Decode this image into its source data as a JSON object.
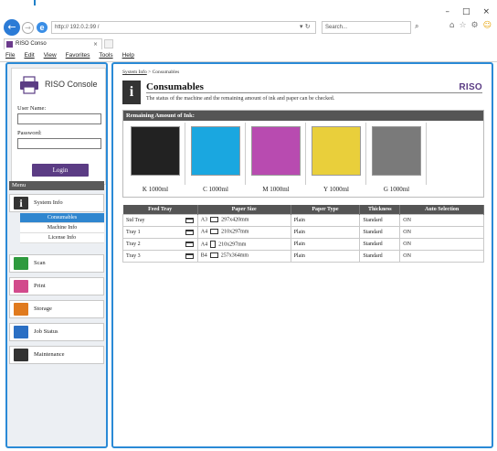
{
  "window": {
    "min": "–",
    "max": "□",
    "close": "×"
  },
  "browser": {
    "back": "←",
    "forward": "→",
    "ie_logo": "e",
    "url": "http:// 192.0.2.99 /",
    "url_actions": "▾ ↻",
    "search_placeholder": "Search...",
    "search_icon": "⌕",
    "tab_title": "RISO Conso",
    "tab_close": "×",
    "menus": [
      "File",
      "Edit",
      "View",
      "Favorites",
      "Tools",
      "Help"
    ],
    "toolbar_icons": {
      "home": "⌂",
      "favorites": "☆",
      "settings": "⚙",
      "feedback": "☺"
    }
  },
  "login": {
    "logo_text": "RISO Console",
    "username_label": "User Name:",
    "password_label": "Password:",
    "button_label": "Login"
  },
  "menu": {
    "header": "Menu",
    "items": [
      {
        "label": "System Info",
        "icon": "info-icon",
        "color": "#333333"
      },
      {
        "label": "Scan",
        "icon": "scan-icon",
        "color": "#2e9a3e"
      },
      {
        "label": "Print",
        "icon": "print-icon",
        "color": "#d24a8c"
      },
      {
        "label": "Storage",
        "icon": "storage-icon",
        "color": "#e07a1e"
      },
      {
        "label": "Job Status",
        "icon": "job-status-icon",
        "color": "#2a6fc4"
      },
      {
        "label": "Maintenance",
        "icon": "maintenance-icon",
        "color": "#333333"
      }
    ],
    "subitems": [
      {
        "label": "Consumables",
        "active": true
      },
      {
        "label": "Machine Info",
        "active": false
      },
      {
        "label": "License Info",
        "active": false
      }
    ]
  },
  "page": {
    "breadcrumb_link": "System Info",
    "breadcrumb_current": " > Consumables",
    "title": "Consumables",
    "description": "The status of the machine and the remaining amount of ink and paper can be checked.",
    "brand": "RISO",
    "icon_glyph": "i"
  },
  "ink": {
    "header": "Remaining Amount of Ink:",
    "cartridges": [
      {
        "label": "K 1000ml",
        "color": "#222222"
      },
      {
        "label": "C 1000ml",
        "color": "#1aa7e0"
      },
      {
        "label": "M 1000ml",
        "color": "#b84bb0"
      },
      {
        "label": "Y 1000ml",
        "color": "#e9cf3b"
      },
      {
        "label": "G 1000ml",
        "color": "#7a7a7a"
      }
    ]
  },
  "trays": {
    "headers": [
      "Feed Tray",
      "Paper Size",
      "Paper Type",
      "Thickness",
      "Auto Selection"
    ],
    "rows": [
      {
        "tray": "Std Tray",
        "size_code": "A3",
        "size": "297x420mm",
        "type": "Plain",
        "thickness": "Standard",
        "auto": "ON"
      },
      {
        "tray": "Tray 1",
        "size_code": "A4",
        "size": "210x297mm",
        "type": "Plain",
        "thickness": "Standard",
        "auto": "ON"
      },
      {
        "tray": "Tray 2",
        "size_code": "A4",
        "size": "210x297mm",
        "type": "Plain",
        "thickness": "Standard",
        "auto": "ON"
      },
      {
        "tray": "Tray 3",
        "size_code": "B4",
        "size": "257x364mm",
        "type": "Plain",
        "thickness": "Standard",
        "auto": "ON"
      }
    ]
  }
}
